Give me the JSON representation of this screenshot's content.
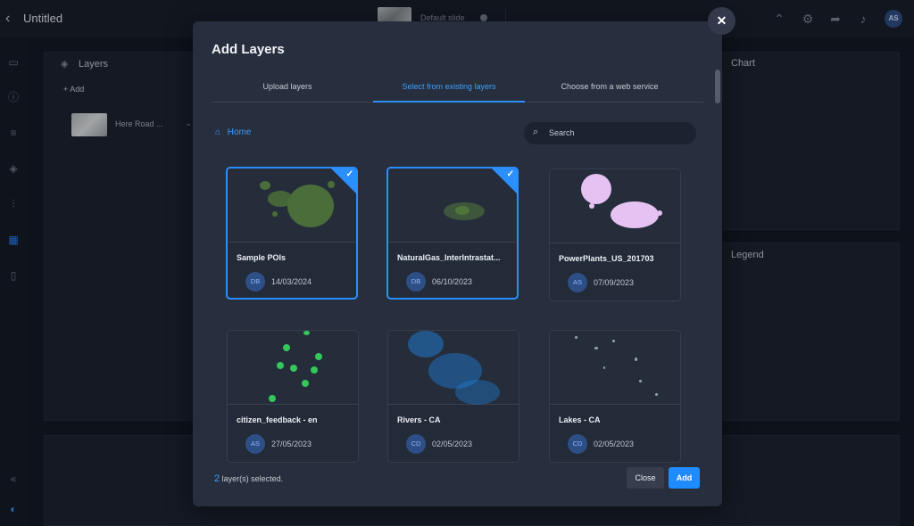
{
  "app": {
    "title": "Untitled",
    "slide": {
      "name": "Default slide"
    },
    "avatar": "AS"
  },
  "panels": {
    "layers": {
      "title": "Layers",
      "add_label": "Add",
      "items": [
        {
          "name": "Here Road ..."
        }
      ]
    },
    "chart": {
      "title": "Chart"
    },
    "legend": {
      "title": "Legend"
    }
  },
  "modal": {
    "title": "Add Layers",
    "tabs": [
      {
        "label": "Upload layers"
      },
      {
        "label": "Select from existing layers"
      },
      {
        "label": "Choose from a web service"
      }
    ],
    "breadcrumb": "Home",
    "search_placeholder": "Search",
    "cards": [
      {
        "name": "Sample POIs",
        "initials": "DB",
        "date": "14/03/2024",
        "selected": true
      },
      {
        "name": "NaturalGas_InterIntrastat...",
        "initials": "DB",
        "date": "06/10/2023",
        "selected": true
      },
      {
        "name": "PowerPlants_US_201703",
        "initials": "AS",
        "date": "07/09/2023",
        "selected": false
      },
      {
        "name": "citizen_feedback - en",
        "initials": "AS",
        "date": "27/05/2023",
        "selected": false
      },
      {
        "name": "Rivers - CA",
        "initials": "CD",
        "date": "02/05/2023",
        "selected": false
      },
      {
        "name": "Lakes - CA",
        "initials": "CD",
        "date": "02/05/2023",
        "selected": false
      }
    ],
    "footer": {
      "count": "2",
      "suffix": " layer(s) selected."
    },
    "buttons": {
      "close": "Close",
      "add": "Add"
    }
  },
  "colors": {
    "accent": "#2b8fff",
    "poi": "#4a6d3a",
    "gas": "#5e8a3c",
    "plants": "#e6c2f2",
    "feedback": "#34c759",
    "rivers": "#1f7ed6",
    "lakes": "#9aa4b5"
  }
}
